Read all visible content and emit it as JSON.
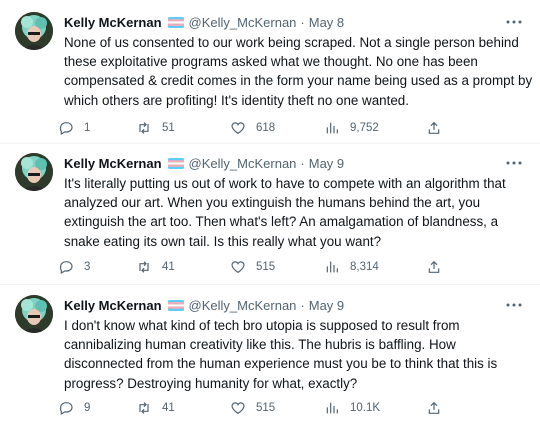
{
  "tweets": [
    {
      "author": "Kelly McKernan",
      "handle": "@Kelly_McKernan",
      "separator": "·",
      "date": "May 8",
      "text": "None of us consented to our work being scraped. Not a single person behind these exploitative programs asked what we thought. No one has been compensated & credit comes in the form your name being used as a prompt by which others are profiting! It's identity theft no one wanted.",
      "replies": "1",
      "retweets": "51",
      "likes": "618",
      "views": "9,752"
    },
    {
      "author": "Kelly McKernan",
      "handle": "@Kelly_McKernan",
      "separator": "·",
      "date": "May 9",
      "text": "It's literally putting us out of work to have to compete with an algorithm that analyzed our art. When you extinguish the humans behind the art, you extinguish the art too. Then what's left? An amalgamation of blandness, a snake eating its own tail. Is this really what you want?",
      "replies": "3",
      "retweets": "41",
      "likes": "515",
      "views": "8,314"
    },
    {
      "author": "Kelly McKernan",
      "handle": "@Kelly_McKernan",
      "separator": "·",
      "date": "May 9",
      "text": "I don't know what kind of tech bro utopia is supposed to result from cannibalizing human creativity like this. The hubris is baffling. How disconnected from the human experience must you be to think that this is progress? Destroying humanity for what, exactly?",
      "replies": "9",
      "retweets": "41",
      "likes": "515",
      "views": "10.1K"
    }
  ],
  "colors": {
    "text": "#0f1419",
    "secondary": "#536471",
    "flag_blue": "#5bcefa",
    "flag_pink": "#f5a9b8",
    "divider": "#eff3f4"
  },
  "icons": {
    "flag": "trans-flag-emoji",
    "more": "more-horizontal-icon",
    "reply": "reply-icon",
    "retweet": "retweet-icon",
    "like": "heart-icon",
    "views": "views-chart-icon",
    "share": "share-icon"
  }
}
